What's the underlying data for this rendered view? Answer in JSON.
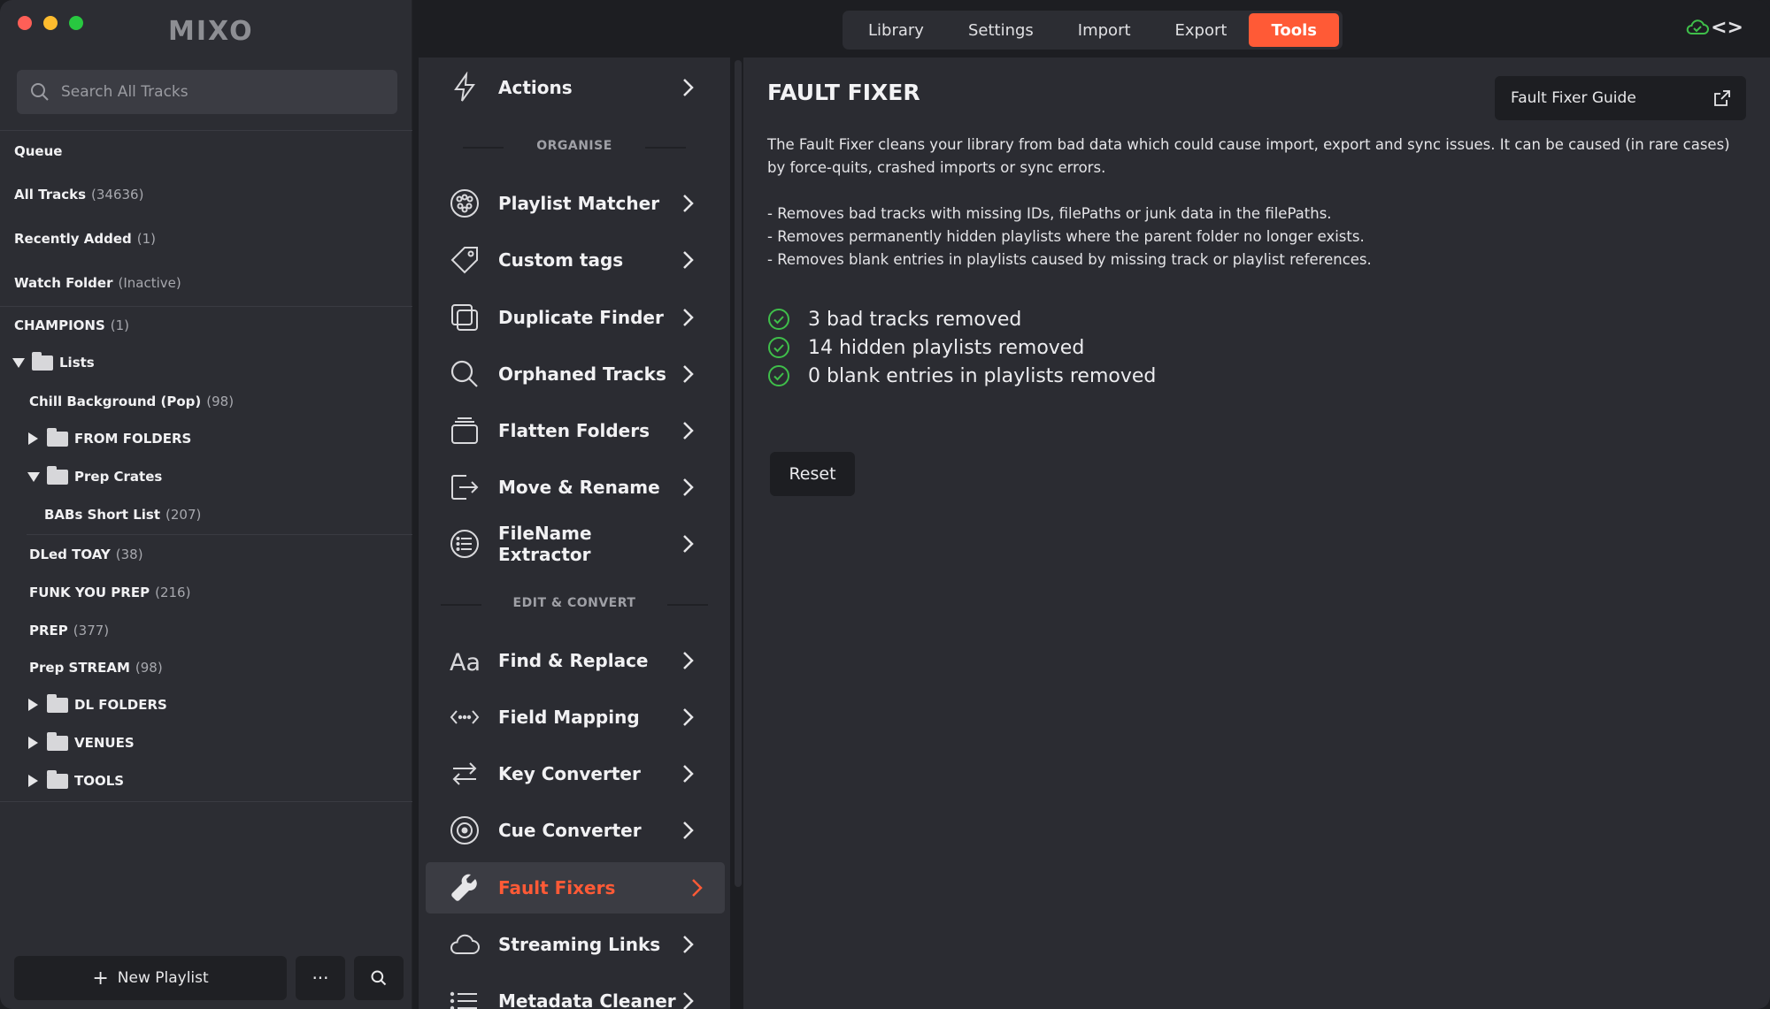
{
  "app": {
    "logo_text": "MIXO"
  },
  "sidebar": {
    "search_placeholder": "Search All Tracks",
    "queue": "Queue",
    "all_tracks": {
      "label": "All Tracks",
      "count": "(34636)"
    },
    "recently_added": {
      "label": "Recently Added",
      "count": "(1)"
    },
    "watch_folder": {
      "label": "Watch Folder",
      "count": "(Inactive)"
    },
    "champions": {
      "label": "CHAMPIONS",
      "count": "(1)"
    },
    "lists": "Lists",
    "chill_background": {
      "label": "Chill Background (Pop)",
      "count": "(98)"
    },
    "from_folders": "FROM FOLDERS",
    "prep_crates": "Prep Crates",
    "babs_short_list": {
      "label": "BABs Short List",
      "count": "(207)"
    },
    "dled_toay": {
      "label": "DLed TOAY",
      "count": "(38)"
    },
    "funk_you_prep": {
      "label": "FUNK YOU PREP",
      "count": "(216)"
    },
    "prep": {
      "label": "PREP",
      "count": "(377)"
    },
    "prep_stream": {
      "label": "Prep STREAM",
      "count": "(98)"
    },
    "dl_folders": "DL FOLDERS",
    "venues": "VENUES",
    "tools": "TOOLS",
    "new_playlist": "New Playlist",
    "more": "···"
  },
  "topbar": {
    "tabs": [
      "Library",
      "Settings",
      "Import",
      "Export",
      "Tools"
    ],
    "active_tab": "Tools",
    "accent_color": "#ff5a36",
    "sync_status_color": "#3fbf4a"
  },
  "tools_menu": {
    "actions": "Actions",
    "organise": "ORGANISE",
    "playlist_matcher": "Playlist Matcher",
    "custom_tags": "Custom tags",
    "duplicate_finder": "Duplicate Finder",
    "orphaned_tracks": "Orphaned Tracks",
    "flatten_folders": "Flatten Folders",
    "move_rename": "Move & Rename",
    "filename_extractor": "FileName Extractor",
    "edit_convert": "EDIT & CONVERT",
    "find_replace": "Find & Replace",
    "field_mapping": "Field Mapping",
    "key_converter": "Key Converter",
    "cue_converter": "Cue Converter",
    "fault_fixers": "Fault Fixers",
    "streaming_links": "Streaming Links",
    "metadata_cleaner": "Metadata Cleaner",
    "active_item": "Fault Fixers"
  },
  "content": {
    "title": "FAULT FIXER",
    "guide_button": "Fault Fixer Guide",
    "description": "The Fault Fixer cleans your library from bad data which could cause import, export and sync issues. It can be caused (in rare cases) by force-quits, crashed imports or sync errors.",
    "bullets": [
      "- Removes bad tracks with missing IDs, filePaths or junk data in the filePaths.",
      "- Removes permanently hidden playlists where the parent folder no longer exists.",
      "- Removes blank entries in playlists caused by missing track or playlist references."
    ],
    "results": [
      "3 bad tracks removed",
      "14 hidden playlists removed",
      "0 blank entries in playlists removed"
    ],
    "success_color": "#3fbf4a",
    "reset_button": "Reset"
  }
}
